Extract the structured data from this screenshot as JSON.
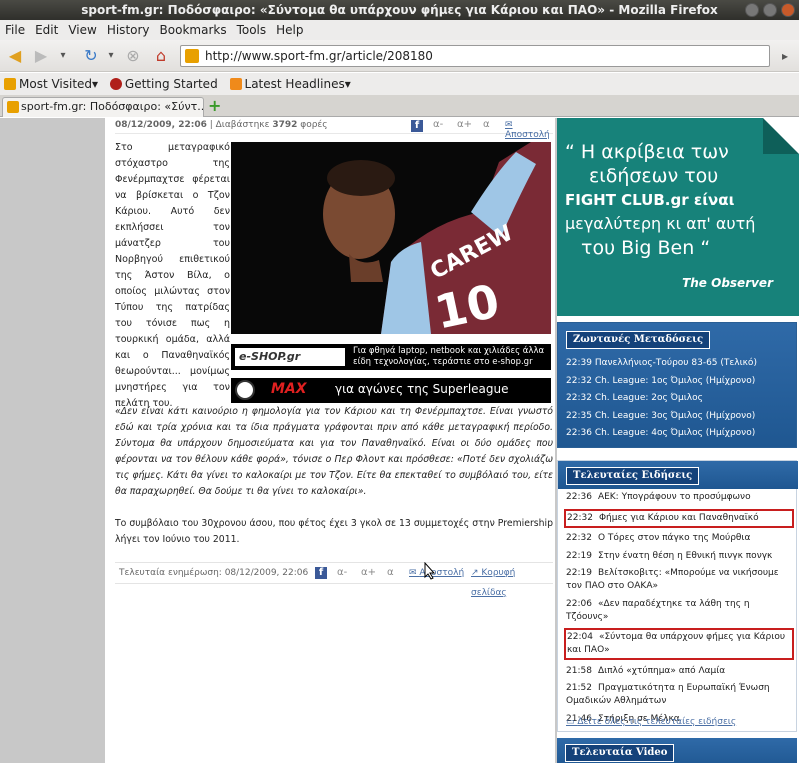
{
  "window": {
    "title": "sport-fm.gr: Ποδόσφαιρο: «Σύντομα θα υπάρχουν φήμες για Κάριου και ΠΑΟ» - Mozilla Firefox"
  },
  "menu": [
    "File",
    "Edit",
    "View",
    "History",
    "Bookmarks",
    "Tools",
    "Help"
  ],
  "url": "http://www.sport-fm.gr/article/208180",
  "bookmarks": [
    "Most Visited",
    "Getting Started",
    "Latest Headlines"
  ],
  "tab": {
    "title": "sport-fm.gr: Ποδόσφαιρο: «Σύντ..."
  },
  "article": {
    "meta_date": "08/12/2009, 22:06",
    "meta_read_prefix": "| Διαβάστηκε",
    "meta_read_count": "3792",
    "meta_read_suffix": "φορές",
    "mail_link": "Αποστολή",
    "font_small": "α-",
    "font_big": "α+",
    "font_normal": "α",
    "lede": "Στο μεταγραφικό στόχαστρο της Φενέρμπαχτσε φέρεται να βρίσκεται ο Τζον Κάριου. Αυτό δεν εκπλήσσει τον μάνατζερ του Νορβηγού επιθετικού της Άστον Βίλα, ο οποίος μιλώντας στον Τύπου της πατρίδας του τόνισε πως η τουρκική ομάδα, αλλά και ο Παναθηναϊκός θεωρούνται... μονίμως μνηστήρες για τον πελάτη του.",
    "quote": "«Δεν είναι κάτι καινούριο η φημολογία για τον Κάριου και τη Φενέρμπαχτσε. Είναι γνωστό εδώ και τρία χρόνια και τα ίδια πράγματα γράφονται πριν από κάθε μεταγραφική περίοδο. Σύντομα θα υπάρχουν δημοσιεύματα και για τον Παναθηναϊκό. Είναι οι δύο ομάδες που φέρονται να τον θέλουν κάθε φορά», τόνισε ο Περ Φλοντ και πρόσθεσε: «Ποτέ δεν σχολιάζω τις φήμες. Κάτι θα γίνει το καλοκαίρι με τον Τζον. Είτε θα επεκταθεί το συμβόλαιό του, είτε θα παραχωρηθεί. Θα δούμε τι θα γίνει το καλοκαίρι».",
    "closing": "Το συμβόλαιο του 30χρονου άσου, που φέτος έχει 3 γκολ σε 13 συμμετοχές στην Premiership λήγει τον Ιούνιο του 2011.",
    "updated": "Τελευταία ενημέρωση: 08/12/2009, 22:06",
    "top_link": "Κορυφή σελίδας",
    "jersey_name": "CAREW",
    "jersey_number": "10",
    "banner1_brand": "e-SHOP.gr",
    "banner1_text": "Για φθηνά laptop, netbook και χιλιάδες άλλα είδη τεχνολογίας, τεράστιε στο e-shop.gr",
    "banner2_brand": "MAX",
    "banner2_text": "για αγώνες της Superleague"
  },
  "ad": {
    "lines": [
      "“ Η ακρίβεια των",
      "ειδήσεων του",
      "FIGHT CLUB.gr είναι",
      "μεγαλύτερη κι απ' αυτή",
      "του Big Ben “"
    ],
    "source": "The Observer"
  },
  "live": {
    "heading": "Ζωντανές Μεταδόσεις",
    "items": [
      {
        "time": "22:39",
        "text": "Πανελλήνιος-Τούρου 83-65 (Τελικό)"
      },
      {
        "time": "22:32",
        "text": "Ch. League: 1ος Όμιλος (Ημίχρονο)"
      },
      {
        "time": "22:32",
        "text": "Ch. League: 2ος Όμιλος"
      },
      {
        "time": "22:35",
        "text": "Ch. League: 3ος Όμιλος (Ημίχρονο)"
      },
      {
        "time": "22:36",
        "text": "Ch. League: 4ος Όμιλος (Ημίχρονο)"
      }
    ]
  },
  "news": {
    "heading": "Τελευταίες Ειδήσεις",
    "items": [
      {
        "time": "22:36",
        "text": "ΑΕΚ: Υπογράφουν το προσύμφωνο",
        "highlight": false
      },
      {
        "time": "22:32",
        "text": "Φήμες για Κάριου και Παναθηναϊκό",
        "highlight": true
      },
      {
        "time": "22:32",
        "text": "Ο Τόρες στον πάγκο της Μούρθια",
        "highlight": false
      },
      {
        "time": "22:19",
        "text": "Στην ένατη θέση η Εθνική πινγκ πονγκ",
        "highlight": false
      },
      {
        "time": "22:19",
        "text": "Βελίτσκοβιτς: «Μπορούμε να νικήσουμε τον ΠΑΟ στο ΟΑΚΑ»",
        "highlight": false
      },
      {
        "time": "22:06",
        "text": "«Δεν παραδέχτηκε τα λάθη της η Τζόουνς»",
        "highlight": false
      },
      {
        "time": "22:04",
        "text": "«Σύντομα θα υπάρχουν φήμες για Κάριου και ΠΑΟ»",
        "highlight": true
      },
      {
        "time": "21:58",
        "text": "Διπλό «χτύπημα» από Λαμία",
        "highlight": false
      },
      {
        "time": "21:52",
        "text": "Πραγματικότητα η Ευρωπαϊκή Ένωση Ομαδικών Αθλημάτων",
        "highlight": false
      },
      {
        "time": "21:46",
        "text": "Στήριξη σε Μέλκα",
        "highlight": false
      }
    ],
    "all_link": "Δείτε όλες τις τελευταίες ειδήσεις"
  },
  "video": {
    "heading": "Τελευταία Video"
  },
  "colors": {
    "panel_blue": "#1f5791",
    "ad_teal": "#17827a",
    "highlight_red": "#c81e1e",
    "link": "#4a6fa5"
  }
}
